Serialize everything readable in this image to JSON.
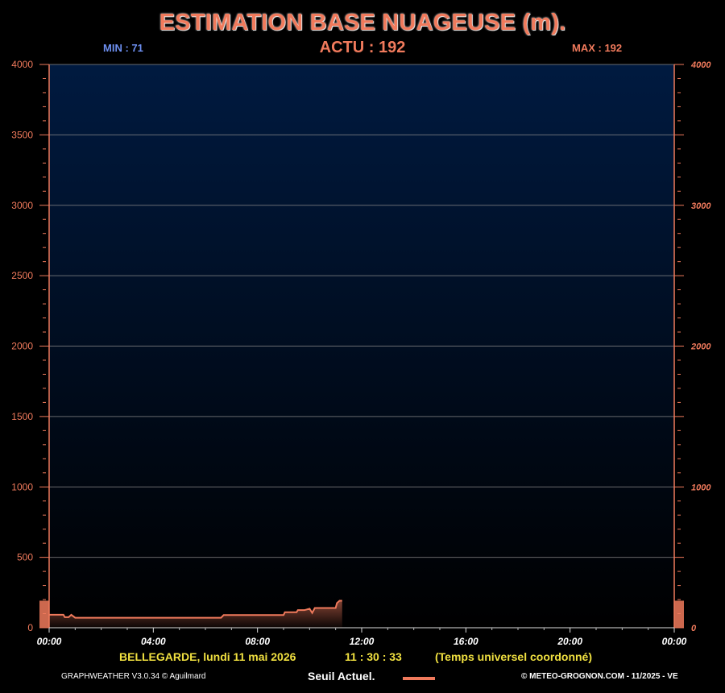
{
  "header": {
    "title": "ESTIMATION BASE NUAGEUSE (m).",
    "min_label": "MIN : 71",
    "actu_label": "ACTU : 192",
    "max_label": "MAX : 192"
  },
  "footer": {
    "location_date": "BELLEGARDE, lundi 11 mai 2026",
    "time": "11 : 30 : 33",
    "timezone": "(Temps universel coordonné)",
    "credit_left": "GRAPHWEATHER V3.0.34 © Aguilmard",
    "legend_label": "Seuil Actuel.",
    "credit_right": "© METEO-GROGNON.COM - 11/2025 - VE"
  },
  "colors": {
    "accent": "#f07a5c",
    "min_color": "#6d8ff0",
    "footer_text": "#f0e040",
    "plot_top": "#001a40",
    "plot_bottom": "#000000"
  },
  "chart_data": {
    "type": "area",
    "title": "ESTIMATION BASE NUAGEUSE (m).",
    "xlabel": "",
    "ylabel": "",
    "xlim": [
      0,
      24
    ],
    "ylim": [
      0,
      4000
    ],
    "grid": true,
    "left_ticks": [
      "0",
      "500",
      "1000",
      "1500",
      "2000",
      "2500",
      "3000",
      "3500",
      "4000"
    ],
    "right_ticks": [
      "0",
      "1000",
      "2000",
      "3000",
      "4000"
    ],
    "x_ticks": [
      "00:00",
      "04:00",
      "08:00",
      "12:00",
      "16:00",
      "20:00",
      "00:00"
    ],
    "series": [
      {
        "x": [
          0.0,
          0.55,
          0.6,
          0.75,
          0.85,
          1.0,
          1.7,
          2.5,
          4.0,
          6.0,
          6.6,
          6.7,
          7.0,
          8.0,
          9.0,
          9.05,
          9.5,
          9.55,
          9.8,
          10.0,
          10.1,
          10.2,
          10.3,
          10.6,
          11.0,
          11.05,
          11.15,
          11.25
        ],
        "y": [
          92,
          92,
          75,
          75,
          92,
          71,
          71,
          71,
          71,
          71,
          71,
          90,
          90,
          90,
          90,
          110,
          110,
          125,
          125,
          135,
          105,
          140,
          140,
          140,
          140,
          175,
          192,
          192
        ]
      }
    ],
    "current_threshold": 192
  }
}
